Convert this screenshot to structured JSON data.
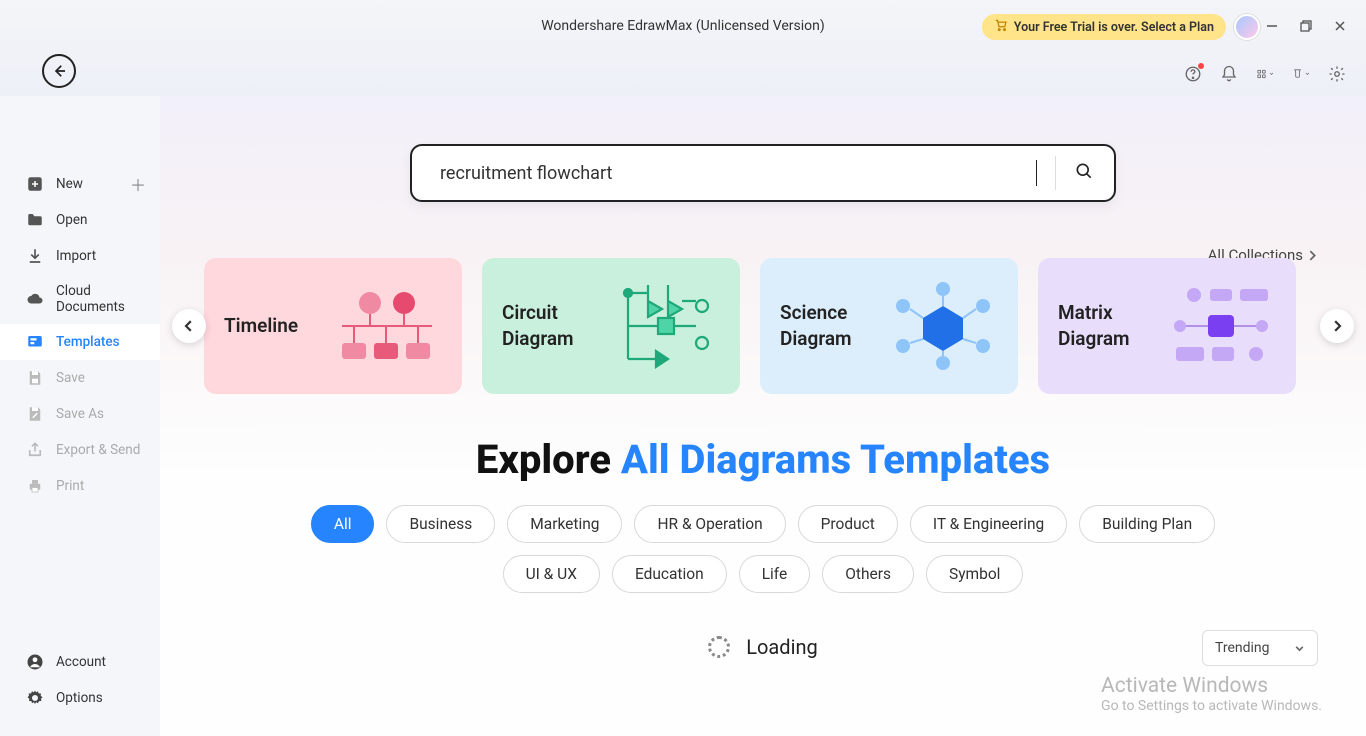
{
  "titlebar": {
    "title": "Wondershare EdrawMax (Unlicensed Version)",
    "trial_text": "Your Free Trial is over. Select a Plan"
  },
  "sidebar": {
    "items": [
      {
        "label": "New",
        "icon": "plus-square",
        "disabled": false,
        "has_plus": true
      },
      {
        "label": "Open",
        "icon": "folder",
        "disabled": false
      },
      {
        "label": "Import",
        "icon": "download",
        "disabled": false
      },
      {
        "label": "Cloud Documents",
        "icon": "cloud",
        "disabled": false
      },
      {
        "label": "Templates",
        "icon": "templates",
        "disabled": false,
        "active": true
      },
      {
        "label": "Save",
        "icon": "save",
        "disabled": true
      },
      {
        "label": "Save As",
        "icon": "save-as",
        "disabled": true
      },
      {
        "label": "Export & Send",
        "icon": "export",
        "disabled": true
      },
      {
        "label": "Print",
        "icon": "print",
        "disabled": true
      }
    ],
    "bottom": [
      {
        "label": "Account",
        "icon": "account"
      },
      {
        "label": "Options",
        "icon": "gear"
      }
    ]
  },
  "search": {
    "value": "recruitment flowchart"
  },
  "all_collections": "All Collections",
  "cards": [
    {
      "label": "Timeline",
      "theme": "pink"
    },
    {
      "label": "Circuit Diagram",
      "theme": "green"
    },
    {
      "label": "Science Diagram",
      "theme": "blue"
    },
    {
      "label": "Matrix Diagram",
      "theme": "purple"
    }
  ],
  "explore": {
    "prefix": "Explore ",
    "accent": "All Diagrams Templates"
  },
  "filters": [
    "All",
    "Business",
    "Marketing",
    "HR & Operation",
    "Product",
    "IT & Engineering",
    "Building Plan",
    "UI & UX",
    "Education",
    "Life",
    "Others",
    "Symbol"
  ],
  "filter_active": "All",
  "sort": {
    "selected": "Trending"
  },
  "loading_text": "Loading",
  "watermark": {
    "l1": "Activate Windows",
    "l2": "Go to Settings to activate Windows."
  }
}
